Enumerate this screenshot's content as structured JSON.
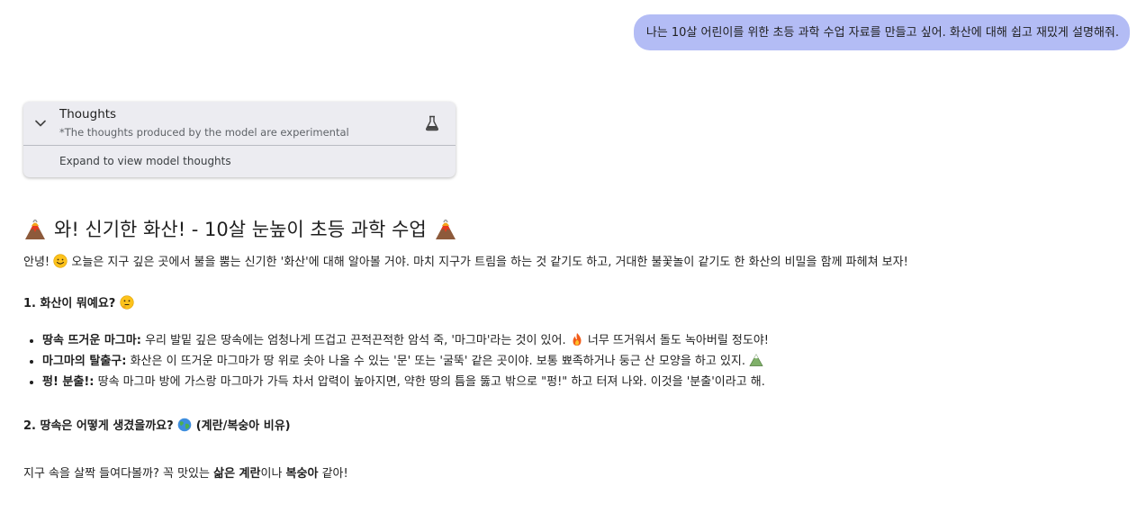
{
  "user_message": "나는 10살 어린이를 위한 초등 과학 수업 자료를 만들고 싶어. 화산에 대해 쉽고 재밌게 설명해줘.",
  "thoughts": {
    "title": "Thoughts",
    "subtitle": "*The thoughts produced by the model are experimental",
    "expand_label": "Expand to view model thoughts"
  },
  "response": {
    "heading": "와! 신기한 화산! - 10살 눈높이 초등 과학 수업",
    "intro_a": "안녕!",
    "intro_b": "오늘은 지구 깊은 곳에서 불을 뿜는 신기한 '화산'에 대해 알아볼 거야. 마치 지구가 트림을 하는 것 같기도 하고, 거대한 불꽃놀이 같기도 한 화산의 비밀을 함께 파헤쳐 보자!",
    "section1_title": "1. 화산이 뭐예요?",
    "bullets": [
      {
        "bold": "땅속 뜨거운 마그마:",
        "text": "우리 발밑 깊은 땅속에는 엄청나게 뜨겁고 끈적끈적한 암석 죽, '마그마'라는 것이 있어.",
        "tail": "너무 뜨거워서 돌도 녹아버릴 정도야!"
      },
      {
        "bold": "마그마의 탈출구:",
        "text": "화산은 이 뜨거운 마그마가 땅 위로 솟아 나올 수 있는 '문' 또는 '굴뚝' 같은 곳이야. 보통 뾰족하거나 둥근 산 모양을 하고 있지.",
        "tail": ""
      },
      {
        "bold": "펑! 분출!:",
        "text": "땅속 마그마 방에 가스랑 마그마가 가득 차서 압력이 높아지면, 약한 땅의 틈을 뚫고 밖으로 \"펑!\" 하고 터져 나와. 이것을 '분출'이라고 해.",
        "tail": ""
      }
    ],
    "section2_title": "2. 땅속은 어떻게 생겼을까요?",
    "section2_suffix": "(계란/복숭아 비유)",
    "closing_a": "지구 속을 살짝 들여다볼까? 꼭 맛있는",
    "closing_bold1": "삶은 계란",
    "closing_b": "이나",
    "closing_bold2": "복숭아",
    "closing_c": "같아!"
  },
  "icons": {
    "heading_left": "volcano-emoji",
    "heading_right": "volcano-emoji",
    "intro": "smiling-face-emoji",
    "section1": "thinking-face-emoji",
    "bullet1": "fire-emoji",
    "bullet2": "mountain-emoji",
    "section2": "globe-emoji",
    "thoughts_toggle": "chevron-down-icon",
    "thoughts_badge": "flask-icon"
  },
  "colors": {
    "user_bubble": "#b3bcf5",
    "thoughts_card": "#ececf1"
  }
}
